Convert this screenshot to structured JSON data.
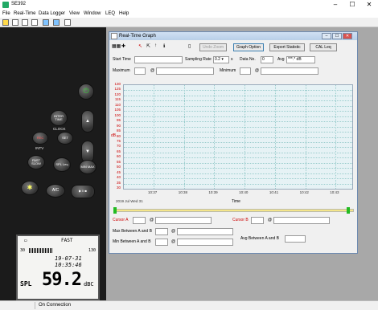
{
  "app": {
    "title": "SE392"
  },
  "menu": [
    "File",
    "Real-Time",
    "Data Logger",
    "View",
    "Window",
    "LEQ",
    "Help"
  ],
  "meter": {
    "buttons": {
      "power": "⏻",
      "inter_time": "INTER TIME",
      "rec": "REC",
      "set": "SET",
      "fast_slow": "FAST SLOW",
      "spl_leq": "SPL Leq",
      "min_max": "MIN MAX",
      "light": "✱",
      "ac": "A/C",
      "play": "▶ II ■"
    },
    "labels": {
      "clock": "CLOCK",
      "intv": "INTV"
    },
    "lcd": {
      "battery": "▭",
      "mode": "FAST",
      "range_low": "30",
      "range_high": "130",
      "date": "19-07-31",
      "time": "10:35:46",
      "spl_label": "SPL",
      "value": "59.2",
      "unit": "dBC"
    }
  },
  "graph_window": {
    "title": "Real-Time Graph",
    "toolbar": {
      "undo_zoom": "Undo Zoom",
      "graph_option": "Graph Option",
      "export_statistic": "Export Statistic",
      "cal_leq": "CAL Leq"
    },
    "fields": {
      "start_time_label": "Start Time",
      "start_time_value": "",
      "sampling_rate_label": "Sampling Rate",
      "sampling_rate_value": "0.2",
      "sampling_rate_unit": "s",
      "data_no_label": "Data No.",
      "data_no_value": "0",
      "avg_label": "Avg",
      "avg_value": "***.* dB",
      "maximum_label": "Maximum",
      "maximum_value": "",
      "minimum_label": "Minimum",
      "minimum_value": "",
      "at": "@"
    },
    "chart_data": {
      "type": "line",
      "title": "",
      "xlabel": "Time",
      "ylabel": "dB",
      "ylim": [
        30,
        130
      ],
      "y_ticks": [
        "130",
        "125",
        "120",
        "115",
        "110",
        "105",
        "100",
        "95",
        "90",
        "85",
        "80",
        "75",
        "70",
        "65",
        "60",
        "55",
        "50",
        "45",
        "40",
        "35",
        "30"
      ],
      "x_ticks": [
        "10:37",
        "10:38",
        "10:39",
        "10:40",
        "10:41",
        "10:42",
        "10:43"
      ],
      "date_label": "2019 Jul Wed 31",
      "grid": true,
      "series": []
    },
    "cursors": {
      "cursor_a_label": "Cursor A",
      "cursor_b_label": "Cursor B",
      "max_between_label": "Max Between A and B",
      "min_between_label": "Min Between A and B",
      "avg_between_label": "Avg Between A and B",
      "at": "@"
    }
  },
  "status": {
    "connection": "On Connection"
  }
}
